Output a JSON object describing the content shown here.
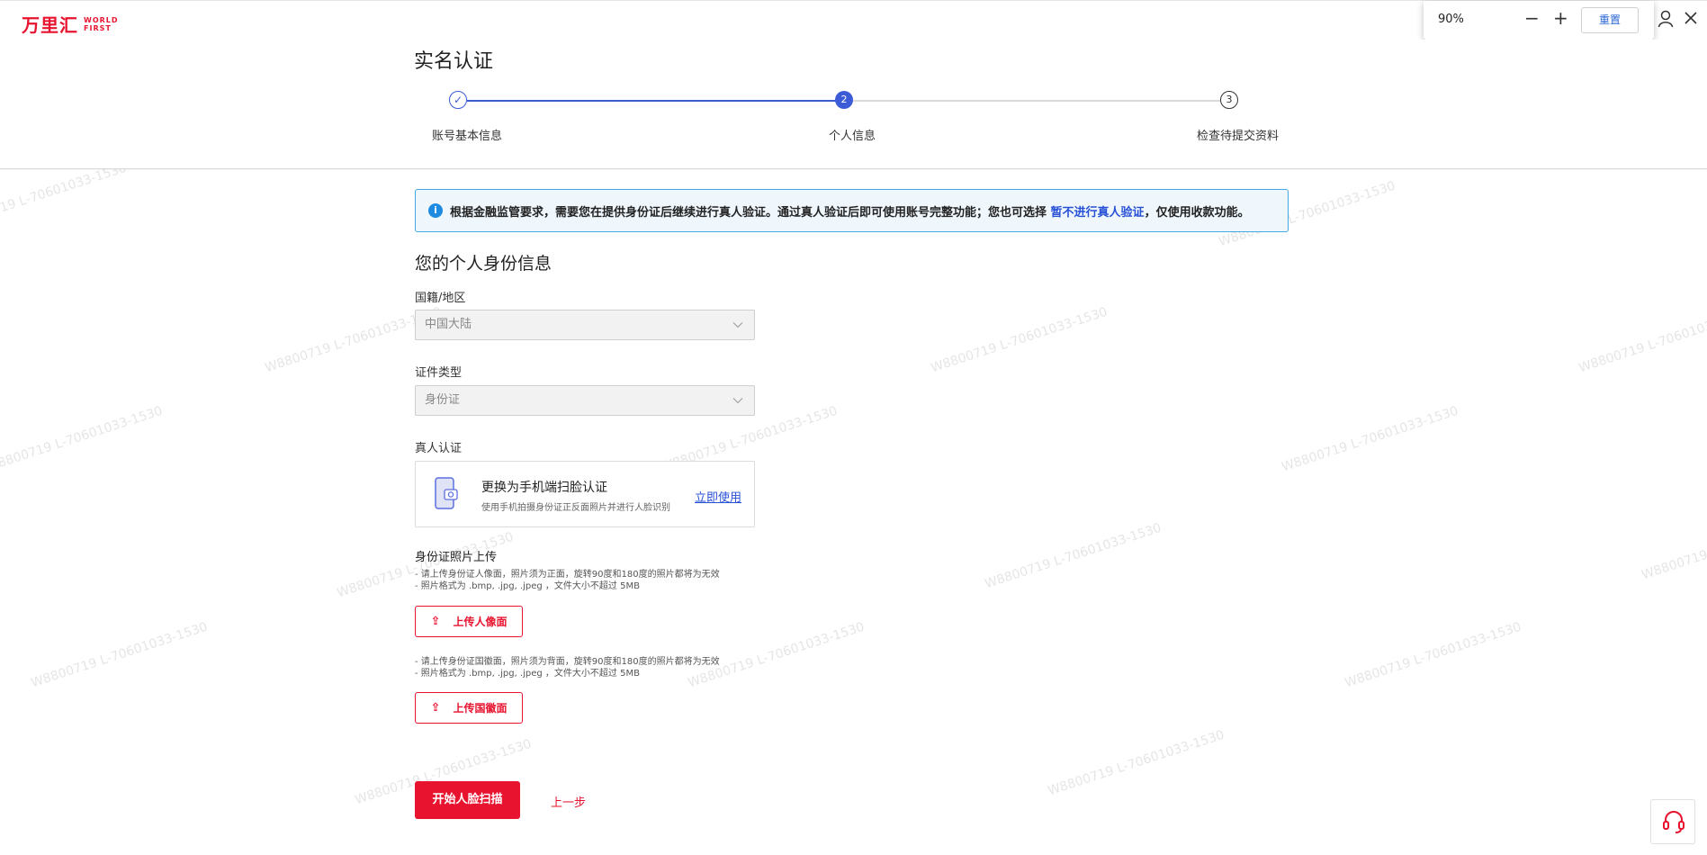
{
  "brand": {
    "name_cn": "万里汇",
    "name_en_line1": "WORLD",
    "name_en_line2": "FIRST",
    "color": "#e8132f"
  },
  "zoom": {
    "level": "90%",
    "minus": "−",
    "plus": "+",
    "reset_label": "重置"
  },
  "page": {
    "title": "实名认证"
  },
  "steps": [
    {
      "index": "✓",
      "label": "账号基本信息",
      "state": "done"
    },
    {
      "index": "2",
      "label": "个人信息",
      "state": "active"
    },
    {
      "index": "3",
      "label": "检查待提交资料",
      "state": "todo"
    }
  ],
  "banner": {
    "icon": "i",
    "text_before": "根据金融监管要求，需要您在提供身份证后继续进行真人验证。通过真人验证后即可使用账号完整功能；您也可选择",
    "link": "暂不进行真人验证",
    "text_after": "，仅使用收款功能。"
  },
  "form": {
    "section_title": "您的个人身份信息",
    "nationality_label": "国籍/地区",
    "nationality_value": "中国大陆",
    "id_type_label": "证件类型",
    "id_type_value": "身份证",
    "face_label": "真人认证",
    "face_card": {
      "title": "更换为手机端扫脸认证",
      "subtitle": "使用手机拍摄身份证正反面照片并进行人脸识别",
      "action": "立即使用"
    },
    "upload_title": "身份证照片上传",
    "front_hints": [
      "- 请上传身份证人像面，照片须为正面，旋转90度和180度的照片都将为无效",
      "- 照片格式为 .bmp, .jpg, .jpeg ，文件大小不超过 5MB"
    ],
    "front_button": "上传人像面",
    "back_hints": [
      "- 请上传身份证国徽面，照片须为背面，旋转90度和180度的照片都将为无效",
      "- 照片格式为 .bmp, .jpg, .jpeg ，文件大小不超过 5MB"
    ],
    "back_button": "上传国徽面",
    "upload_icon": "⇪"
  },
  "actions": {
    "primary": "开始人脸扫描",
    "back": "上一步"
  },
  "watermark_text": "W8800719 L-70601033-1530",
  "colors": {
    "accent": "#e8132f",
    "step_blue": "#3c5bd7",
    "link_blue": "#2750d6",
    "banner_border": "#41a8e3"
  }
}
